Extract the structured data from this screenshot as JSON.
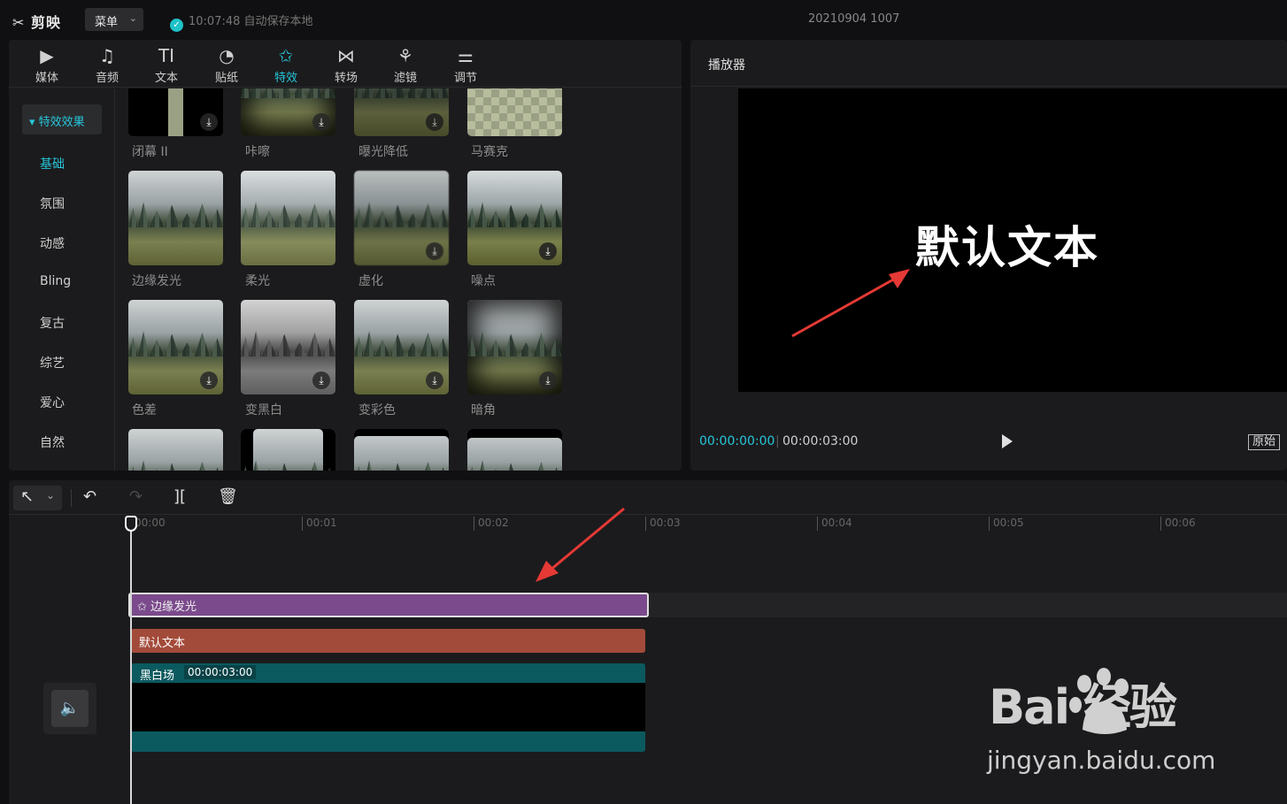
{
  "app": {
    "logo": "剪映",
    "menu_label": "菜单",
    "autosave": "10:07:48 自动保存本地",
    "project_name": "20210904 1007"
  },
  "tabs": [
    {
      "label": "媒体",
      "icon": "media-icon"
    },
    {
      "label": "音频",
      "icon": "audio-icon"
    },
    {
      "label": "文本",
      "icon": "text-icon"
    },
    {
      "label": "贴纸",
      "icon": "sticker-icon"
    },
    {
      "label": "特效",
      "icon": "effects-icon",
      "active": true
    },
    {
      "label": "转场",
      "icon": "transition-icon"
    },
    {
      "label": "滤镜",
      "icon": "filter-icon"
    },
    {
      "label": "调节",
      "icon": "adjust-icon"
    }
  ],
  "sidebar": {
    "header": "特效效果",
    "items": [
      "基础",
      "氛围",
      "动感",
      "Bling",
      "复古",
      "综艺",
      "爱心",
      "自然"
    ],
    "selected": "基础"
  },
  "effects": {
    "row1": [
      "闭幕 II",
      "咔嚓",
      "曝光降低",
      "马赛克"
    ],
    "row2": [
      "边缘发光",
      "柔光",
      "虚化",
      "噪点"
    ],
    "row3": [
      "色差",
      "变黑白",
      "变彩色",
      "暗角"
    ]
  },
  "player": {
    "title": "播放器",
    "preview_text": "默认文本",
    "current_time": "00:00:00:00",
    "total_time": "00:00:03:00",
    "original_label": "原始"
  },
  "timeline": {
    "ruler": [
      "00:00",
      "00:01",
      "00:02",
      "00:03",
      "00:04",
      "00:05",
      "00:06"
    ],
    "effect_clip": "边缘发光",
    "text_clip": "默认文本",
    "video_clip": {
      "name": "黑白场",
      "duration": "00:00:03:00"
    }
  },
  "watermark": {
    "brand": "Bai  经验",
    "url": "jingyan.baidu.com"
  },
  "colors": {
    "accent": "#26c6da",
    "effect_clip": "#7b4a8c",
    "text_clip": "#a34b3a",
    "video_clip": "#0b5a5f",
    "annotation_arrow": "#e53935"
  }
}
